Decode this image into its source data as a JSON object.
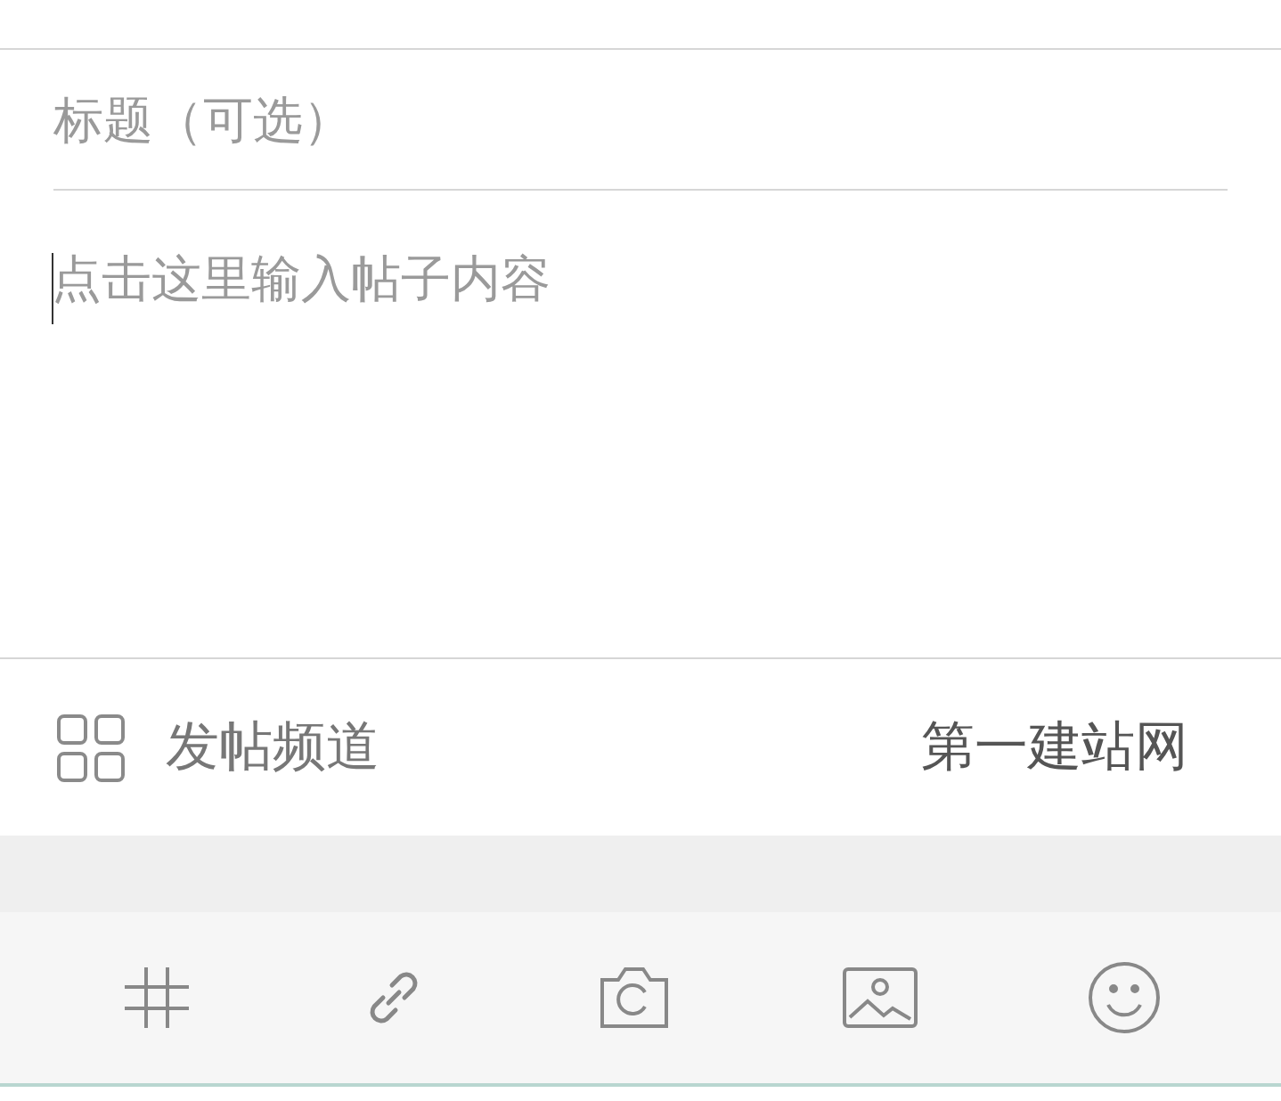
{
  "title_field": {
    "placeholder": "标题（可选）"
  },
  "content_field": {
    "placeholder": "点击这里输入帖子内容"
  },
  "channel_row": {
    "label": "发帖频道",
    "value": "第一建站网"
  }
}
